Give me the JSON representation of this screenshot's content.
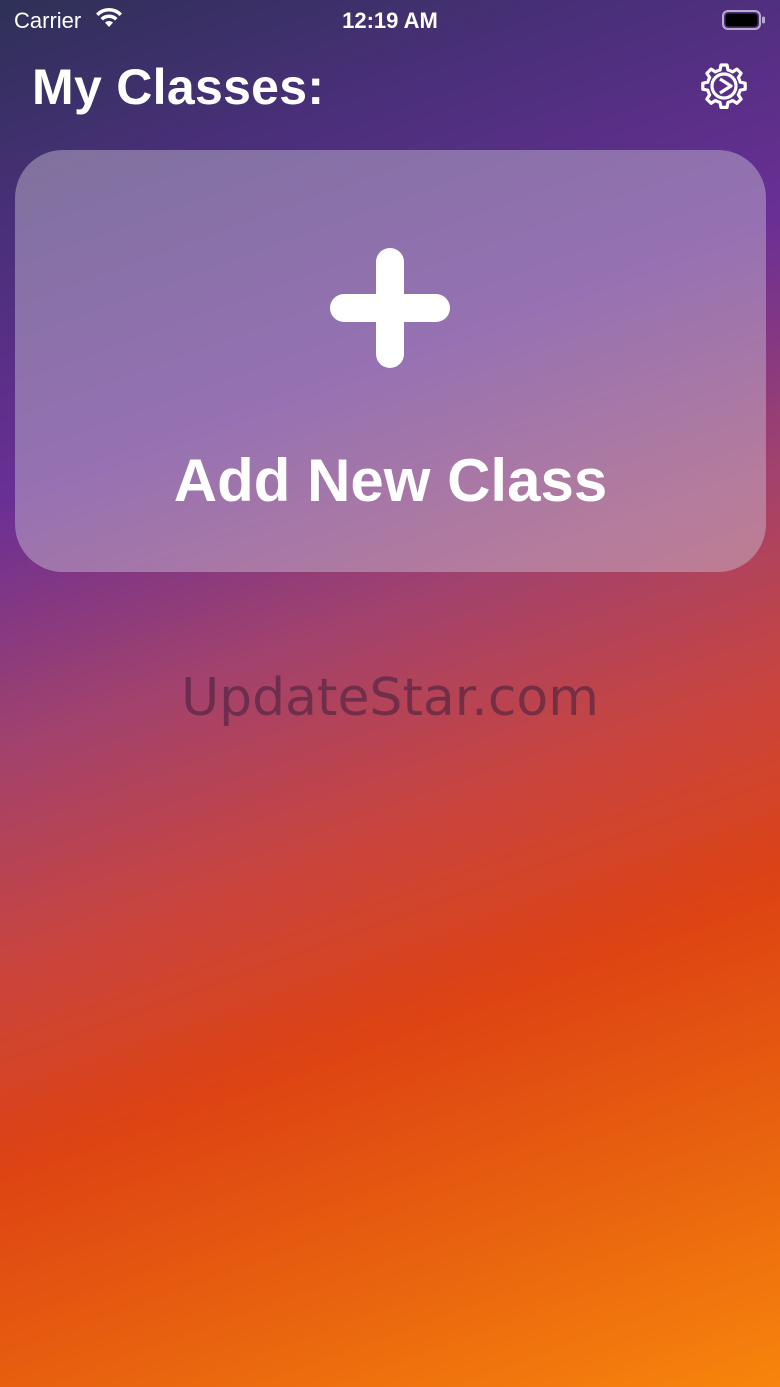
{
  "status_bar": {
    "carrier": "Carrier",
    "time": "12:19 AM",
    "wifi_icon": "wifi-icon",
    "battery_icon": "battery-icon"
  },
  "header": {
    "title": "My Classes:",
    "settings_icon": "gear-icon"
  },
  "add_card": {
    "icon": "plus-icon",
    "label": "Add New Class"
  },
  "watermark": {
    "text": "UpdateStar.com"
  },
  "colors": {
    "gradient_top": "#2e3157",
    "gradient_purple": "#6a2f95",
    "gradient_red": "#dd4313",
    "gradient_bottom": "#f7850c",
    "text": "#ffffff"
  }
}
